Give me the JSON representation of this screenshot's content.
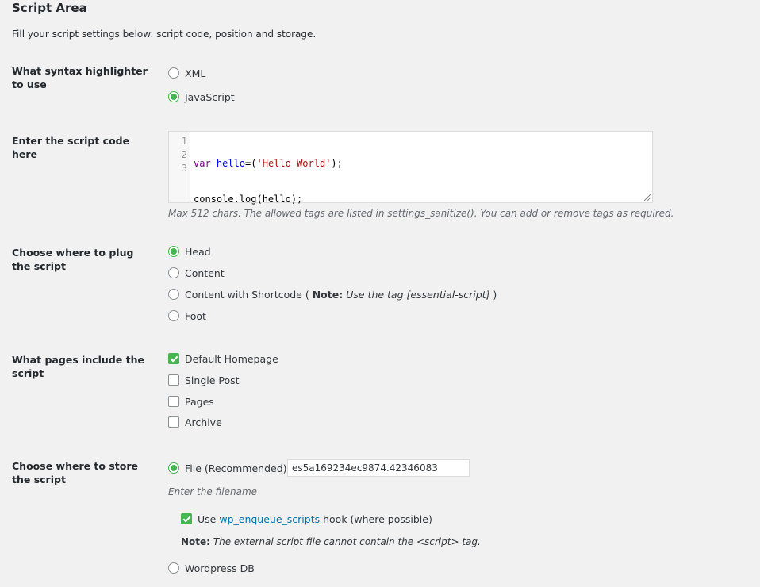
{
  "section": {
    "title": "Script Area",
    "description": "Fill your script settings below: script code, position and storage."
  },
  "syntax": {
    "label": "What syntax highlighter to use",
    "options": [
      "XML",
      "JavaScript"
    ],
    "selected": "JavaScript"
  },
  "code": {
    "label": "Enter the script code here",
    "line_numbers": [
      "1",
      "2",
      "3"
    ],
    "lines": {
      "l1_kw": "var",
      "l1_var": "hello",
      "l1_mid": "=(",
      "l1_str": "'Hello World'",
      "l1_end": ");",
      "l2": "console.log(hello);"
    },
    "hint": "Max 512 chars. The allowed tags are listed in settings_sanitize(). You can add or remove tags as required."
  },
  "position": {
    "label": "Choose where to plug the script",
    "options": {
      "head": "Head",
      "content": "Content",
      "shortcode": "Content with Shortcode (",
      "shortcode_note_label": "Note:",
      "shortcode_note_text": "Use the tag [essential-script]",
      "shortcode_close": ")",
      "foot": "Foot"
    },
    "selected": "Head"
  },
  "pages": {
    "label": "What pages include the script",
    "options": {
      "homepage": "Default Homepage",
      "single_post": "Single Post",
      "pages": "Pages",
      "archive": "Archive"
    },
    "checked": [
      "Default Homepage"
    ]
  },
  "storage": {
    "label": "Choose where to store the script",
    "file_option": "File (Recommended)",
    "filename_value": "es5a169234ec9874.42346083",
    "filename_hint": "Enter the filename",
    "enqueue_prefix": "Use",
    "enqueue_link": "wp_enqueue_scripts",
    "enqueue_suffix": "hook (where possible)",
    "note_label": "Note:",
    "note_text": "The external script file cannot contain the <script> tag.",
    "db_option": "Wordpress DB",
    "selected": "File (Recommended)"
  },
  "colors": {
    "accent_green": "#46b450",
    "link_blue": "#0073aa",
    "background": "#f1f1f1"
  }
}
